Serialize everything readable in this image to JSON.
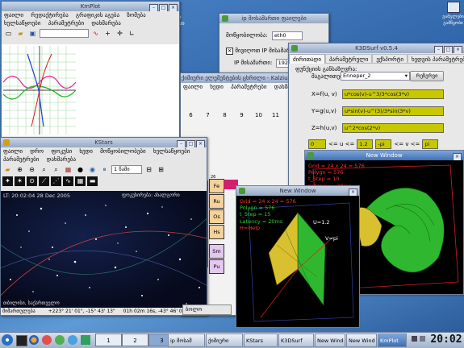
{
  "desktop": {
    "icon_top_label": "ქართ\nსერვისი",
    "icon_right_label": "გამგლები\nგამწყობი"
  },
  "kmplot": {
    "title": "KmPlot",
    "menus": [
      "ფაილი",
      "რედაქტირება",
      "გრაფიკის აგება",
      "ზომება",
      "ხელსაწყოები",
      "პარამეტრები",
      "დახმარება"
    ]
  },
  "ipdialog": {
    "title": "ip მოსამართი ფაილები",
    "row1_label": "მოწყობილობა:",
    "row1_value": "eth0",
    "checkbox_label": "მივიღოთ IP მისამართი",
    "ip_label": "IP მისამართი:",
    "ip_value": "192"
  },
  "kalzium": {
    "title": "ქიმიური ელემენტების ცხრილი - Kalzium",
    "menus": [
      "ფაილი",
      "ხედი",
      "პარამეტრები",
      "დახმარება"
    ],
    "group_numbers": [
      "6",
      "7",
      "8",
      "9",
      "10",
      "11"
    ],
    "elements": [
      "Fe",
      "Ru",
      "Os",
      "Hs",
      "Sm",
      "Pu"
    ],
    "numbers": [
      "26",
      "44",
      "76",
      "108",
      "62",
      "94"
    ],
    "footer": "ბოლო"
  },
  "k3dsurf": {
    "title": "K3DSurf v0.5.4",
    "tabs": [
      "ძირითადი",
      "პარამეტრული",
      "ექსპორტი",
      "ხედვის პარამეტრები"
    ],
    "group_label": "ფუნქციის განსაზღვრა:",
    "select_label": "მაგალითები:",
    "select_value": "Enneper_2",
    "calc_button": "რეზერვი",
    "x_label": "X=f(u, v)",
    "x_value": "u*cos(v)-u^3/3*cos(3*v)",
    "y_label": "Y=g(u,v)",
    "y_value": "u*sin(v)-u^(3)/3*sin(3*v)",
    "z_label": "Z=h(u,v)",
    "z_value": "u^2*cos(2*v)",
    "u_min": "0",
    "u_mid": "<= u <=",
    "u_max": "1.2",
    "v_min": "-pi",
    "v_mid": "<= v <=",
    "v_max": "pi"
  },
  "kstars": {
    "title": "KStars",
    "menus": [
      "ფაილი",
      "დრო",
      "ფოკუსი",
      "ხედი",
      "მოწყობილობები",
      "ხელსაწყოები",
      "პარამეტრები",
      "დახმარება"
    ],
    "zoom_value": "1 წამი",
    "time_label": "LT: 20:02:04",
    "date_label": "28 Dec 2005",
    "top_object": "ფოკუსირება: ახალგორი",
    "status_left": "მიმართულება",
    "status_coords": "+223° 21' 01\", -15° 43' 13\"",
    "status_time": "01h 02m 16s, -43° 46' 01\"",
    "location": "თბილისი, საქართველო"
  },
  "newwindow_large": {
    "title": "New Window",
    "info_grid": "Grid = 24 x 24 = 576",
    "info_polygon": "Polygn = 576",
    "info_tstep": "t_Step = 10",
    "info_latency": "Latency = 20ms"
  },
  "newwindow_small": {
    "title": "New Window",
    "info_grid": "Grid = 24 x 24 = 576",
    "info_polygon": "Polygn = 576",
    "info_tstep": "t_Step = 15",
    "info_latency": "Latency = 20ms",
    "info_help": "H=Help",
    "axis_u": "U=1.2",
    "axis_v": "V=pi"
  },
  "bg_strip": {
    "value": "8"
  },
  "taskbar": {
    "desktop_numbers": [
      "1",
      "2",
      "3",
      "4"
    ],
    "tasks": [
      "ip მოსამ",
      "ქიმიური",
      "KStars",
      "K3DSurf",
      "New Wind",
      "New Wind",
      "KmPlot"
    ],
    "clock": "20:02"
  }
}
